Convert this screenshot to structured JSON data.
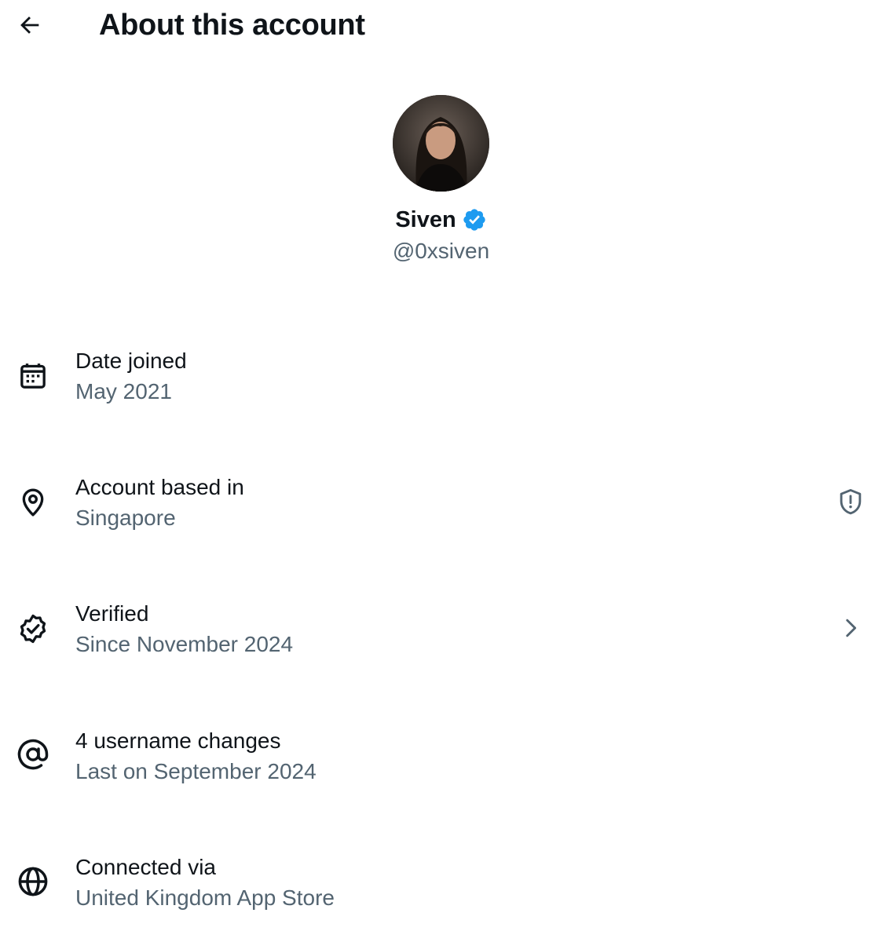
{
  "header": {
    "title": "About this account",
    "back_icon": "arrow-left-icon"
  },
  "profile": {
    "name": "Siven",
    "handle": "@0xsiven",
    "verified": true,
    "badge_color": "#1d9bf0"
  },
  "rows": [
    {
      "label": "Date joined",
      "value": "May 2021",
      "icon": "calendar-icon"
    },
    {
      "label": "Account based in",
      "value": "Singapore",
      "icon": "location-pin-icon",
      "end_icon": "shield-alert-icon"
    },
    {
      "label": "Verified",
      "value": "Since November 2024",
      "icon": "verified-check-icon",
      "end_icon": "chevron-right-icon"
    },
    {
      "label": "4 username changes",
      "value": "Last on September 2024",
      "icon": "at-sign-icon"
    },
    {
      "label": "Connected via",
      "value": "United Kingdom App Store",
      "icon": "globe-icon"
    }
  ],
  "colors": {
    "text_primary": "#0f1419",
    "text_secondary": "#536471",
    "accent": "#1d9bf0"
  }
}
